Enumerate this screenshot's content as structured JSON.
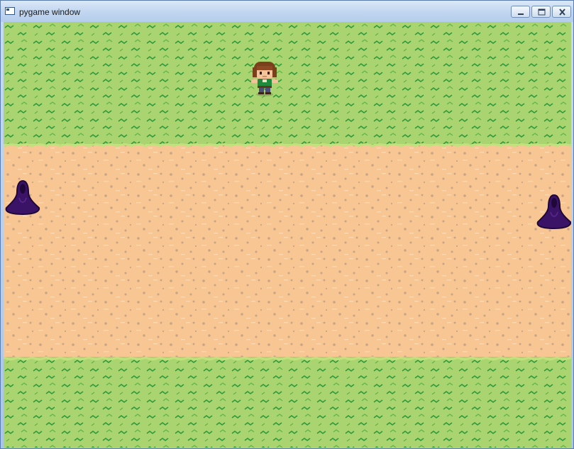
{
  "window": {
    "title": "pygame window",
    "icon": "pygame-window-icon",
    "controls": [
      {
        "name": "minimize-button",
        "icon": "minimize-icon"
      },
      {
        "name": "maximize-button",
        "icon": "maximize-icon"
      },
      {
        "name": "close-button",
        "icon": "close-icon"
      }
    ]
  },
  "scene": {
    "colors": {
      "grass": "#a9d46f",
      "grass_dark": "#2f9a3b",
      "grass_light": "#c2e07e",
      "dirt": "#f8c693",
      "dirt_speck": "#c7a486",
      "dirt_light": "#fbd8b0",
      "ghost": "#3b1366",
      "ghost_outline": "#1e0838"
    },
    "terrain": [
      "grass",
      "dirt",
      "grass"
    ],
    "sprites": [
      {
        "name": "player-character",
        "kind": "player",
        "facing": "down"
      },
      {
        "name": "ghost-enemy-left",
        "kind": "ghost"
      },
      {
        "name": "ghost-enemy-right",
        "kind": "ghost"
      }
    ]
  }
}
